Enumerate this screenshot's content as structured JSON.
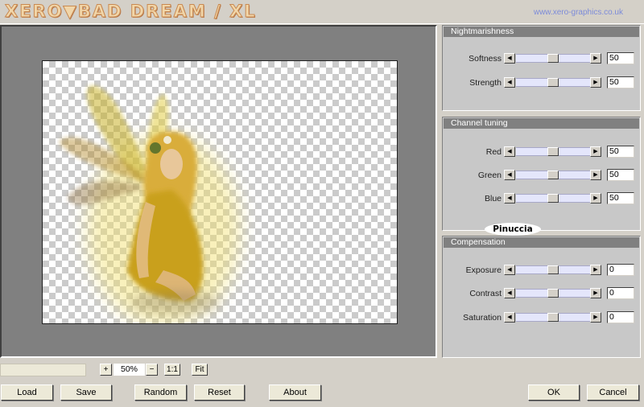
{
  "app": {
    "logo": "XERO▼BAD DREAM / XL",
    "url": "www.xero-graphics.co.uk"
  },
  "panels": {
    "nightmarishness": {
      "title": "Nightmarishness",
      "sliders": [
        {
          "label": "Softness",
          "value": "50",
          "level": 0.5
        },
        {
          "label": "Strength",
          "value": "50",
          "level": 0.5
        }
      ]
    },
    "channel_tuning": {
      "title": "Channel tuning",
      "sliders": [
        {
          "label": "Red",
          "value": "50",
          "level": 0.5
        },
        {
          "label": "Green",
          "value": "50",
          "level": 0.5
        },
        {
          "label": "Blue",
          "value": "50",
          "level": 0.5
        }
      ]
    },
    "compensation": {
      "title": "Compensation",
      "sliders": [
        {
          "label": "Exposure",
          "value": "0",
          "level": 0.5
        },
        {
          "label": "Contrast",
          "value": "0",
          "level": 0.5
        },
        {
          "label": "Saturation",
          "value": "0",
          "level": 0.5
        }
      ]
    }
  },
  "watermark": "Pinuccia",
  "zoom": {
    "plus": "+",
    "value": "50%",
    "minus": "−",
    "one_to_one": "1:1",
    "fit": "Fit"
  },
  "buttons": {
    "load": "Load",
    "save": "Save",
    "random": "Random",
    "reset": "Reset",
    "about": "About",
    "ok": "OK",
    "cancel": "Cancel"
  },
  "icons": {
    "slider_left": "triangle-left-icon",
    "slider_right": "triangle-right-icon"
  }
}
